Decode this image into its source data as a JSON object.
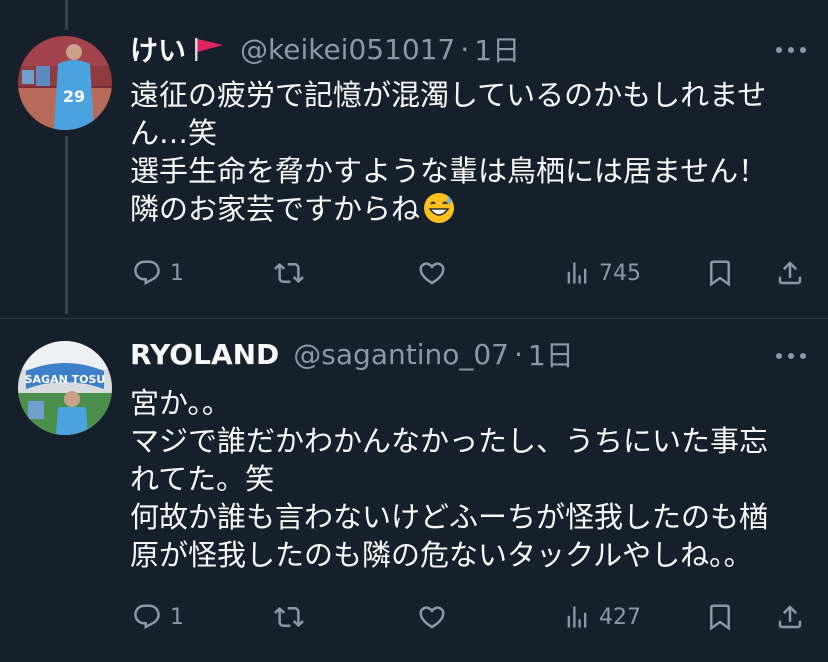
{
  "tweets": [
    {
      "name": "けい",
      "handle": "@keikei051017",
      "separator": "·",
      "time": "1日",
      "lines": [
        "遠征の疲労で記憶が混濁しているのかもしれませ",
        "ん…笑",
        "選手生命を脅かすような輩は鳥栖には居ません！",
        "隣のお家芸ですからね"
      ],
      "emoji": "sweat-smile-emoji",
      "replies": "1",
      "retweets": "",
      "likes": "",
      "views": "745"
    },
    {
      "name": "RYOLAND",
      "handle": "@sagantino_07",
      "separator": "·",
      "time": "1日",
      "lines": [
        "宮か。。",
        "マジで誰だかわかんなかったし、うちにいた事忘",
        "れてた。笑",
        "何故か誰も言わないけどふーちが怪我したのも楢",
        "原が怪我したのも隣の危ないタックルやしね。。"
      ],
      "avatar_text": "SAGAN TOSU",
      "replies": "1",
      "retweets": "",
      "likes": "",
      "views": "427"
    }
  ],
  "colors": {
    "background": "#15202b",
    "text": "#f7f9f9",
    "secondary": "#8b98a5",
    "thread_line": "#38444d",
    "flag_red": "#e0245e"
  },
  "icons": [
    "flag-icon",
    "more-icon",
    "reply-icon",
    "retweet-icon",
    "like-icon",
    "views-icon",
    "bookmark-icon",
    "share-icon"
  ]
}
